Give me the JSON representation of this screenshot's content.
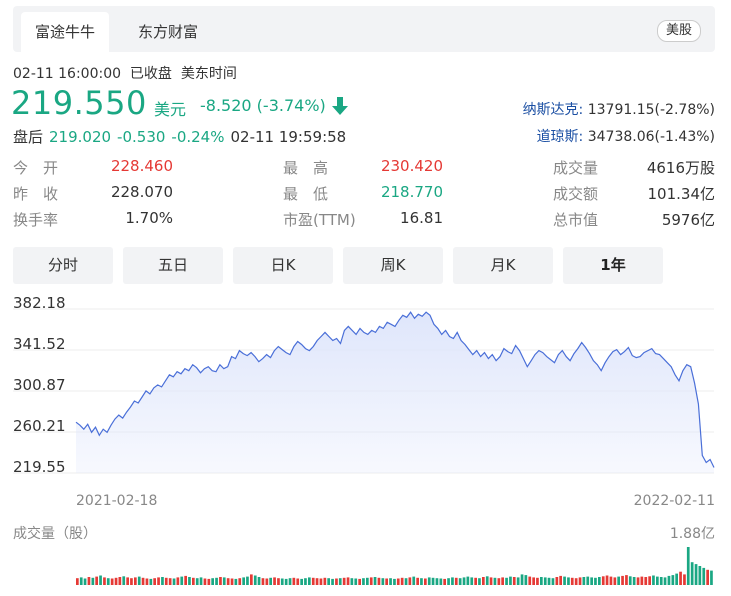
{
  "tabs": [
    {
      "label": "富途牛牛",
      "active": true
    },
    {
      "label": "东方财富",
      "active": false
    }
  ],
  "market_badge": "美股",
  "status": {
    "datetime": "02-11 16:00:00",
    "state": "已收盘",
    "tz": "美东时间"
  },
  "quote": {
    "price": "219.550",
    "currency": "美元",
    "change": "-8.520",
    "change_pct": "(-3.74%)",
    "direction": "down"
  },
  "after_hours": {
    "label": "盘后",
    "price": "219.020",
    "change": "-0.530",
    "change_pct": "-0.24%",
    "time": "02-11 19:59:58"
  },
  "indices": [
    {
      "label": "纳斯达克:",
      "value": "13791.15(-2.78%)"
    },
    {
      "label": "道琼斯:",
      "value": "34738.06(-1.43%)"
    }
  ],
  "stats": [
    [
      {
        "k": "今　开",
        "v": "228.460",
        "c": "red"
      },
      {
        "k": "最　高",
        "v": "230.420",
        "c": "red"
      },
      {
        "k": "成交量",
        "v": "4616万股",
        "c": "plain"
      }
    ],
    [
      {
        "k": "昨　收",
        "v": "228.070",
        "c": "plain"
      },
      {
        "k": "最　低",
        "v": "218.770",
        "c": "green"
      },
      {
        "k": "成交额",
        "v": "101.34亿",
        "c": "plain"
      }
    ],
    [
      {
        "k": "换手率",
        "v": "1.70%",
        "c": "plain"
      },
      {
        "k": "市盈(TTM)",
        "v": "16.81",
        "c": "plain"
      },
      {
        "k": "总市值",
        "v": "5976亿",
        "c": "plain"
      }
    ]
  ],
  "period_buttons": [
    "分时",
    "五日",
    "日K",
    "周K",
    "月K",
    "1年"
  ],
  "active_period": "1年",
  "chart_data": {
    "type": "area",
    "ytick_labels": [
      "382.18",
      "341.52",
      "300.87",
      "260.21",
      "219.55"
    ],
    "ylim": [
      219.55,
      382.18
    ],
    "x_start_label": "2021-02-18",
    "x_end_label": "2022-02-11",
    "values": [
      265,
      262,
      258,
      263,
      255,
      260,
      252,
      258,
      255,
      262,
      268,
      272,
      269,
      275,
      280,
      286,
      284,
      290,
      296,
      293,
      299,
      302,
      300,
      306,
      312,
      310,
      315,
      313,
      318,
      316,
      322,
      319,
      314,
      318,
      320,
      316,
      315,
      322,
      318,
      320,
      330,
      328,
      336,
      333,
      331,
      334,
      330,
      325,
      328,
      332,
      329,
      336,
      340,
      337,
      334,
      332,
      340,
      345,
      342,
      338,
      336,
      340,
      346,
      350,
      354,
      350,
      346,
      348,
      343,
      356,
      360,
      356,
      352,
      358,
      354,
      352,
      356,
      354,
      360,
      358,
      364,
      362,
      360,
      366,
      371,
      369,
      374,
      368,
      372,
      370,
      374,
      371,
      362,
      358,
      352,
      356,
      350,
      348,
      354,
      346,
      342,
      337,
      332,
      336,
      330,
      334,
      328,
      332,
      326,
      330,
      338,
      335,
      333,
      341,
      336,
      328,
      320,
      326,
      332,
      336,
      334,
      330,
      327,
      324,
      332,
      336,
      330,
      326,
      333,
      338,
      344,
      339,
      333,
      326,
      322,
      316,
      324,
      330,
      335,
      337,
      332,
      335,
      339,
      331,
      329,
      330,
      334,
      336,
      338,
      333,
      332,
      328,
      324,
      320,
      312,
      306,
      316,
      322,
      320,
      304,
      283,
      232,
      225,
      228,
      220
    ],
    "volume_max_label": "1.88亿",
    "volume_label": "成交量（股）",
    "volume_values": [
      0.18,
      0.2,
      0.17,
      0.21,
      0.19,
      0.22,
      0.25,
      0.2,
      0.18,
      0.17,
      0.19,
      0.21,
      0.23,
      0.2,
      0.18,
      0.2,
      0.22,
      0.19,
      0.17,
      0.16,
      0.18,
      0.2,
      0.21,
      0.19,
      0.18,
      0.17,
      0.2,
      0.22,
      0.24,
      0.21,
      0.19,
      0.18,
      0.2,
      0.17,
      0.16,
      0.18,
      0.19,
      0.21,
      0.2,
      0.18,
      0.17,
      0.16,
      0.18,
      0.2,
      0.22,
      0.28,
      0.25,
      0.21,
      0.18,
      0.17,
      0.19,
      0.2,
      0.18,
      0.17,
      0.16,
      0.18,
      0.19,
      0.17,
      0.16,
      0.18,
      0.2,
      0.19,
      0.18,
      0.17,
      0.19,
      0.18,
      0.16,
      0.17,
      0.18,
      0.19,
      0.2,
      0.18,
      0.17,
      0.16,
      0.18,
      0.19,
      0.2,
      0.21,
      0.19,
      0.18,
      0.17,
      0.18,
      0.16,
      0.17,
      0.19,
      0.18,
      0.2,
      0.22,
      0.19,
      0.18,
      0.17,
      0.2,
      0.19,
      0.18,
      0.17,
      0.16,
      0.18,
      0.2,
      0.19,
      0.18,
      0.2,
      0.22,
      0.2,
      0.19,
      0.18,
      0.21,
      0.23,
      0.2,
      0.19,
      0.18,
      0.2,
      0.19,
      0.22,
      0.21,
      0.2,
      0.28,
      0.26,
      0.22,
      0.2,
      0.19,
      0.21,
      0.2,
      0.19,
      0.18,
      0.21,
      0.24,
      0.22,
      0.2,
      0.19,
      0.18,
      0.2,
      0.21,
      0.22,
      0.2,
      0.19,
      0.21,
      0.23,
      0.25,
      0.22,
      0.2,
      0.22,
      0.24,
      0.26,
      0.23,
      0.21,
      0.2,
      0.22,
      0.21,
      0.23,
      0.25,
      0.22,
      0.21,
      0.2,
      0.24,
      0.26,
      0.3,
      0.35,
      0.28,
      1.0,
      0.6,
      0.55,
      0.5,
      0.45,
      0.4,
      0.38
    ],
    "line_color": "#4a6fd8",
    "fill_color": "#dfe6fb",
    "volume_color_up": "#e53935",
    "volume_color_down": "#1aa783"
  }
}
